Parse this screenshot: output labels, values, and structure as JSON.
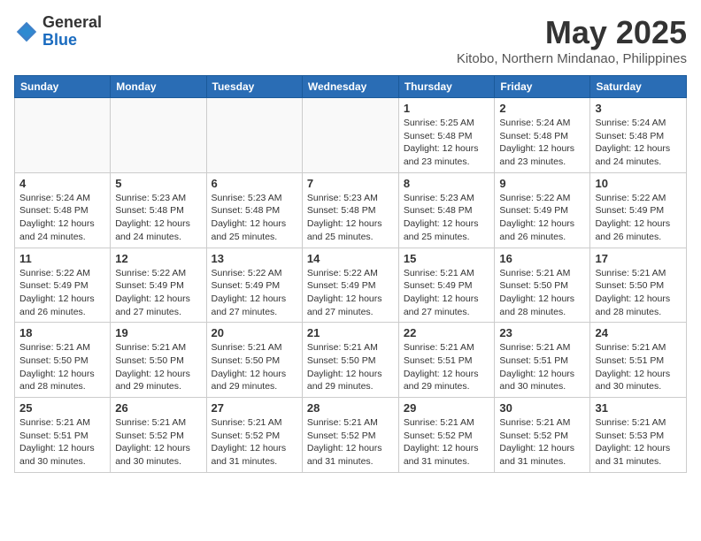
{
  "logo": {
    "general": "General",
    "blue": "Blue"
  },
  "title": "May 2025",
  "location": "Kitobo, Northern Mindanao, Philippines",
  "days_of_week": [
    "Sunday",
    "Monday",
    "Tuesday",
    "Wednesday",
    "Thursday",
    "Friday",
    "Saturday"
  ],
  "weeks": [
    [
      {
        "day": "",
        "info": ""
      },
      {
        "day": "",
        "info": ""
      },
      {
        "day": "",
        "info": ""
      },
      {
        "day": "",
        "info": ""
      },
      {
        "day": "1",
        "info": "Sunrise: 5:25 AM\nSunset: 5:48 PM\nDaylight: 12 hours\nand 23 minutes."
      },
      {
        "day": "2",
        "info": "Sunrise: 5:24 AM\nSunset: 5:48 PM\nDaylight: 12 hours\nand 23 minutes."
      },
      {
        "day": "3",
        "info": "Sunrise: 5:24 AM\nSunset: 5:48 PM\nDaylight: 12 hours\nand 24 minutes."
      }
    ],
    [
      {
        "day": "4",
        "info": "Sunrise: 5:24 AM\nSunset: 5:48 PM\nDaylight: 12 hours\nand 24 minutes."
      },
      {
        "day": "5",
        "info": "Sunrise: 5:23 AM\nSunset: 5:48 PM\nDaylight: 12 hours\nand 24 minutes."
      },
      {
        "day": "6",
        "info": "Sunrise: 5:23 AM\nSunset: 5:48 PM\nDaylight: 12 hours\nand 25 minutes."
      },
      {
        "day": "7",
        "info": "Sunrise: 5:23 AM\nSunset: 5:48 PM\nDaylight: 12 hours\nand 25 minutes."
      },
      {
        "day": "8",
        "info": "Sunrise: 5:23 AM\nSunset: 5:48 PM\nDaylight: 12 hours\nand 25 minutes."
      },
      {
        "day": "9",
        "info": "Sunrise: 5:22 AM\nSunset: 5:49 PM\nDaylight: 12 hours\nand 26 minutes."
      },
      {
        "day": "10",
        "info": "Sunrise: 5:22 AM\nSunset: 5:49 PM\nDaylight: 12 hours\nand 26 minutes."
      }
    ],
    [
      {
        "day": "11",
        "info": "Sunrise: 5:22 AM\nSunset: 5:49 PM\nDaylight: 12 hours\nand 26 minutes."
      },
      {
        "day": "12",
        "info": "Sunrise: 5:22 AM\nSunset: 5:49 PM\nDaylight: 12 hours\nand 27 minutes."
      },
      {
        "day": "13",
        "info": "Sunrise: 5:22 AM\nSunset: 5:49 PM\nDaylight: 12 hours\nand 27 minutes."
      },
      {
        "day": "14",
        "info": "Sunrise: 5:22 AM\nSunset: 5:49 PM\nDaylight: 12 hours\nand 27 minutes."
      },
      {
        "day": "15",
        "info": "Sunrise: 5:21 AM\nSunset: 5:49 PM\nDaylight: 12 hours\nand 27 minutes."
      },
      {
        "day": "16",
        "info": "Sunrise: 5:21 AM\nSunset: 5:50 PM\nDaylight: 12 hours\nand 28 minutes."
      },
      {
        "day": "17",
        "info": "Sunrise: 5:21 AM\nSunset: 5:50 PM\nDaylight: 12 hours\nand 28 minutes."
      }
    ],
    [
      {
        "day": "18",
        "info": "Sunrise: 5:21 AM\nSunset: 5:50 PM\nDaylight: 12 hours\nand 28 minutes."
      },
      {
        "day": "19",
        "info": "Sunrise: 5:21 AM\nSunset: 5:50 PM\nDaylight: 12 hours\nand 29 minutes."
      },
      {
        "day": "20",
        "info": "Sunrise: 5:21 AM\nSunset: 5:50 PM\nDaylight: 12 hours\nand 29 minutes."
      },
      {
        "day": "21",
        "info": "Sunrise: 5:21 AM\nSunset: 5:50 PM\nDaylight: 12 hours\nand 29 minutes."
      },
      {
        "day": "22",
        "info": "Sunrise: 5:21 AM\nSunset: 5:51 PM\nDaylight: 12 hours\nand 29 minutes."
      },
      {
        "day": "23",
        "info": "Sunrise: 5:21 AM\nSunset: 5:51 PM\nDaylight: 12 hours\nand 30 minutes."
      },
      {
        "day": "24",
        "info": "Sunrise: 5:21 AM\nSunset: 5:51 PM\nDaylight: 12 hours\nand 30 minutes."
      }
    ],
    [
      {
        "day": "25",
        "info": "Sunrise: 5:21 AM\nSunset: 5:51 PM\nDaylight: 12 hours\nand 30 minutes."
      },
      {
        "day": "26",
        "info": "Sunrise: 5:21 AM\nSunset: 5:52 PM\nDaylight: 12 hours\nand 30 minutes."
      },
      {
        "day": "27",
        "info": "Sunrise: 5:21 AM\nSunset: 5:52 PM\nDaylight: 12 hours\nand 31 minutes."
      },
      {
        "day": "28",
        "info": "Sunrise: 5:21 AM\nSunset: 5:52 PM\nDaylight: 12 hours\nand 31 minutes."
      },
      {
        "day": "29",
        "info": "Sunrise: 5:21 AM\nSunset: 5:52 PM\nDaylight: 12 hours\nand 31 minutes."
      },
      {
        "day": "30",
        "info": "Sunrise: 5:21 AM\nSunset: 5:52 PM\nDaylight: 12 hours\nand 31 minutes."
      },
      {
        "day": "31",
        "info": "Sunrise: 5:21 AM\nSunset: 5:53 PM\nDaylight: 12 hours\nand 31 minutes."
      }
    ]
  ]
}
